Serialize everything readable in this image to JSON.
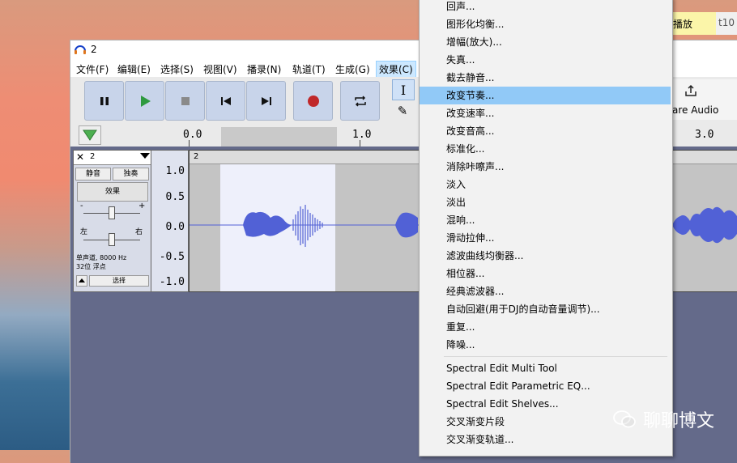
{
  "window": {
    "title": "2"
  },
  "menubar": {
    "items": [
      "文件(F)",
      "编辑(E)",
      "选择(S)",
      "视图(V)",
      "播录(N)",
      "轨道(T)",
      "生成(G)",
      "效果(C)"
    ]
  },
  "timeline": {
    "ticks": [
      "0.0",
      "1.0",
      "3.0"
    ]
  },
  "toolbar": {
    "share_label": "are Audio"
  },
  "track": {
    "name": "2",
    "mute_label": "静音",
    "solo_label": "独奏",
    "effects_label": "效果",
    "gain_minus": "-",
    "gain_plus": "+",
    "pan_left": "左",
    "pan_right": "右",
    "info_line1": "单声道, 8000 Hz",
    "info_line2": "32位 浮点",
    "select_label": "选择",
    "clip_name": "2"
  },
  "vscale": {
    "labels": [
      "1.0",
      "0.5",
      "0.0",
      "-0.5",
      "-1.0"
    ]
  },
  "context_menu": {
    "items": [
      {
        "label": "回声..."
      },
      {
        "label": "图形化均衡..."
      },
      {
        "label": "增幅(放大)..."
      },
      {
        "label": "失真..."
      },
      {
        "label": "截去静音..."
      },
      {
        "label": "改变节奏...",
        "highlighted": true
      },
      {
        "label": "改变速率..."
      },
      {
        "label": "改变音高..."
      },
      {
        "label": "标准化..."
      },
      {
        "label": "消除咔嚓声..."
      },
      {
        "label": "淡入"
      },
      {
        "label": "淡出"
      },
      {
        "label": "混响..."
      },
      {
        "label": "滑动拉伸..."
      },
      {
        "label": "滤波曲线均衡器..."
      },
      {
        "label": "相位器..."
      },
      {
        "label": "经典滤波器..."
      },
      {
        "label": "自动回避(用于DJ的自动音量调节)..."
      },
      {
        "label": "重复..."
      },
      {
        "label": "降噪..."
      },
      {
        "label": "Spectral Edit Multi Tool"
      },
      {
        "label": "Spectral Edit Parametric EQ..."
      },
      {
        "label": "Spectral Edit Shelves..."
      },
      {
        "label": "交叉渐变片段"
      },
      {
        "label": "交叉渐变轨道..."
      }
    ]
  },
  "right_strip": {
    "tab1": "播放",
    "tab2": "t10"
  },
  "watermark": {
    "text": "聊聊博文"
  },
  "colors": {
    "highlight": "#91c9f7",
    "waveform": "#5161d6",
    "button_bg": "#c8d4ea"
  }
}
